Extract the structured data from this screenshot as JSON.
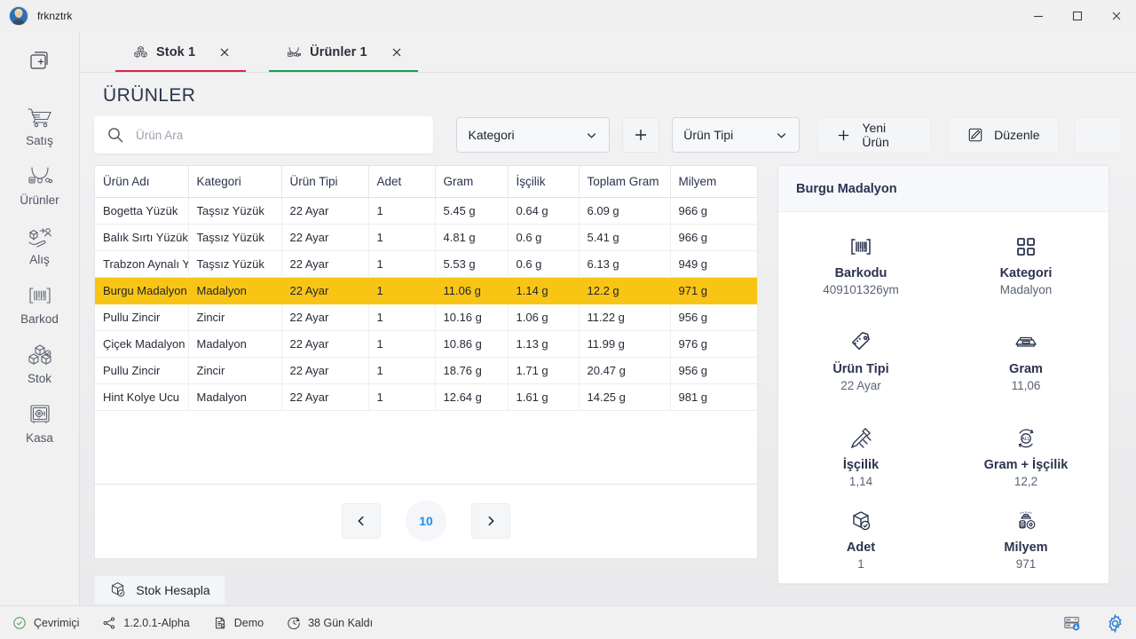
{
  "window": {
    "title": "frknztrk",
    "controls": {
      "minimize": "minimize-icon",
      "maximize": "maximize-icon",
      "close": "close-icon"
    }
  },
  "rail": {
    "new_tab_label": "new-tab-icon",
    "items": [
      {
        "label": "Satış",
        "icon": "cart-icon"
      },
      {
        "label": "Ürünler",
        "icon": "necklace-icon"
      },
      {
        "label": "Alış",
        "icon": "purchase-hand-icon"
      },
      {
        "label": "Barkod",
        "icon": "barcode-icon"
      },
      {
        "label": "Stok",
        "icon": "boxes-icon"
      },
      {
        "label": "Kasa",
        "icon": "safe-icon"
      }
    ]
  },
  "tabs": [
    {
      "label": "Stok 1",
      "icon": "boxes-icon",
      "accent": "#e0244a",
      "active": false
    },
    {
      "label": "Ürünler 1",
      "icon": "products-icon",
      "accent": "#17a24a",
      "active": true
    }
  ],
  "page": {
    "title": "ÜRÜNLER"
  },
  "toolbar": {
    "search_placeholder": "Ürün Ara",
    "search_value": "",
    "kategori_label": "Kategori",
    "add_category_label": "+",
    "urun_tipi_label": "Ürün Tipi",
    "yeni_urun_label": "Yeni Ürün",
    "duzenle_label": "Düzenle"
  },
  "table": {
    "columns": [
      "Ürün Adı",
      "Kategori",
      "Ürün Tipi",
      "Adet",
      "Gram",
      "İşçilik",
      "Toplam Gram",
      "Milyem"
    ],
    "rows": [
      {
        "cells": [
          "Bogetta Yüzük",
          "Taşsız Yüzük",
          "22 Ayar",
          "1",
          "5.45 g",
          "0.64 g",
          "6.09 g",
          "966 g"
        ],
        "selected": false
      },
      {
        "cells": [
          "Balık Sırtı Yüzük",
          "Taşsız Yüzük",
          "22 Ayar",
          "1",
          "4.81 g",
          "0.6 g",
          "5.41 g",
          "966 g"
        ],
        "selected": false
      },
      {
        "cells": [
          "Trabzon Aynalı Yüzük",
          "Taşsız Yüzük",
          "22 Ayar",
          "1",
          "5.53 g",
          "0.6 g",
          "6.13 g",
          "949 g"
        ],
        "selected": false
      },
      {
        "cells": [
          "Burgu Madalyon",
          "Madalyon",
          "22 Ayar",
          "1",
          "11.06 g",
          "1.14 g",
          "12.2 g",
          "971 g"
        ],
        "selected": true
      },
      {
        "cells": [
          "Pullu Zincir",
          "Zincir",
          "22 Ayar",
          "1",
          "10.16 g",
          "1.06 g",
          "11.22 g",
          "956 g"
        ],
        "selected": false
      },
      {
        "cells": [
          "Çiçek Madalyon",
          "Madalyon",
          "22 Ayar",
          "1",
          "10.86 g",
          "1.13 g",
          "11.99 g",
          "976 g"
        ],
        "selected": false
      },
      {
        "cells": [
          "Pullu Zincir",
          "Zincir",
          "22 Ayar",
          "1",
          "18.76 g",
          "1.71 g",
          "20.47 g",
          "956 g"
        ],
        "selected": false
      },
      {
        "cells": [
          "Hint Kolye Ucu",
          "Madalyon",
          "22 Ayar",
          "1",
          "12.64 g",
          "1.61 g",
          "14.25 g",
          "981 g"
        ],
        "selected": false
      }
    ]
  },
  "pagination": {
    "prev": "chevron-left-icon",
    "page": "10",
    "next": "chevron-right-icon"
  },
  "actions": {
    "stok_hesapla": "Stok Hesapla"
  },
  "detail": {
    "title": "Burgu Madalyon",
    "fields": [
      {
        "label": "Barkodu",
        "value": "409101326ym",
        "icon": "barcode-icon"
      },
      {
        "label": "Kategori",
        "value": "Madalyon",
        "icon": "grid-squares-icon"
      },
      {
        "label": "Ürün Tipi",
        "value": "22 Ayar",
        "icon": "price-tag-icon"
      },
      {
        "label": "Gram",
        "value": "11,06",
        "icon": "scale-icon"
      },
      {
        "label": "İşçilik",
        "value": "1,14",
        "icon": "craft-tools-icon"
      },
      {
        "label": "Gram + İşçilik",
        "value": "12,2",
        "icon": "all-circle-icon"
      },
      {
        "label": "Adet",
        "value": "1",
        "icon": "box-check-icon"
      },
      {
        "label": "Milyem",
        "value": "971",
        "icon": "gold-coins-icon"
      }
    ]
  },
  "statusbar": {
    "items": [
      {
        "label": "Çevrimiçi",
        "icon": "check-circle-icon"
      },
      {
        "label": "1.2.0.1-Alpha",
        "icon": "branch-icon"
      },
      {
        "label": "Demo",
        "icon": "document-icon"
      },
      {
        "label": "38 Gün Kaldı",
        "icon": "clock-icon"
      }
    ],
    "right": [
      {
        "icon": "database-download-icon"
      },
      {
        "icon": "gear-icon"
      }
    ]
  },
  "colors": {
    "selected_row": "#f9c515",
    "tab_stok_accent": "#e0244a",
    "tab_urunler_accent": "#17a24a",
    "page_number": "#1f8ef1",
    "heading": "#2b3450"
  }
}
